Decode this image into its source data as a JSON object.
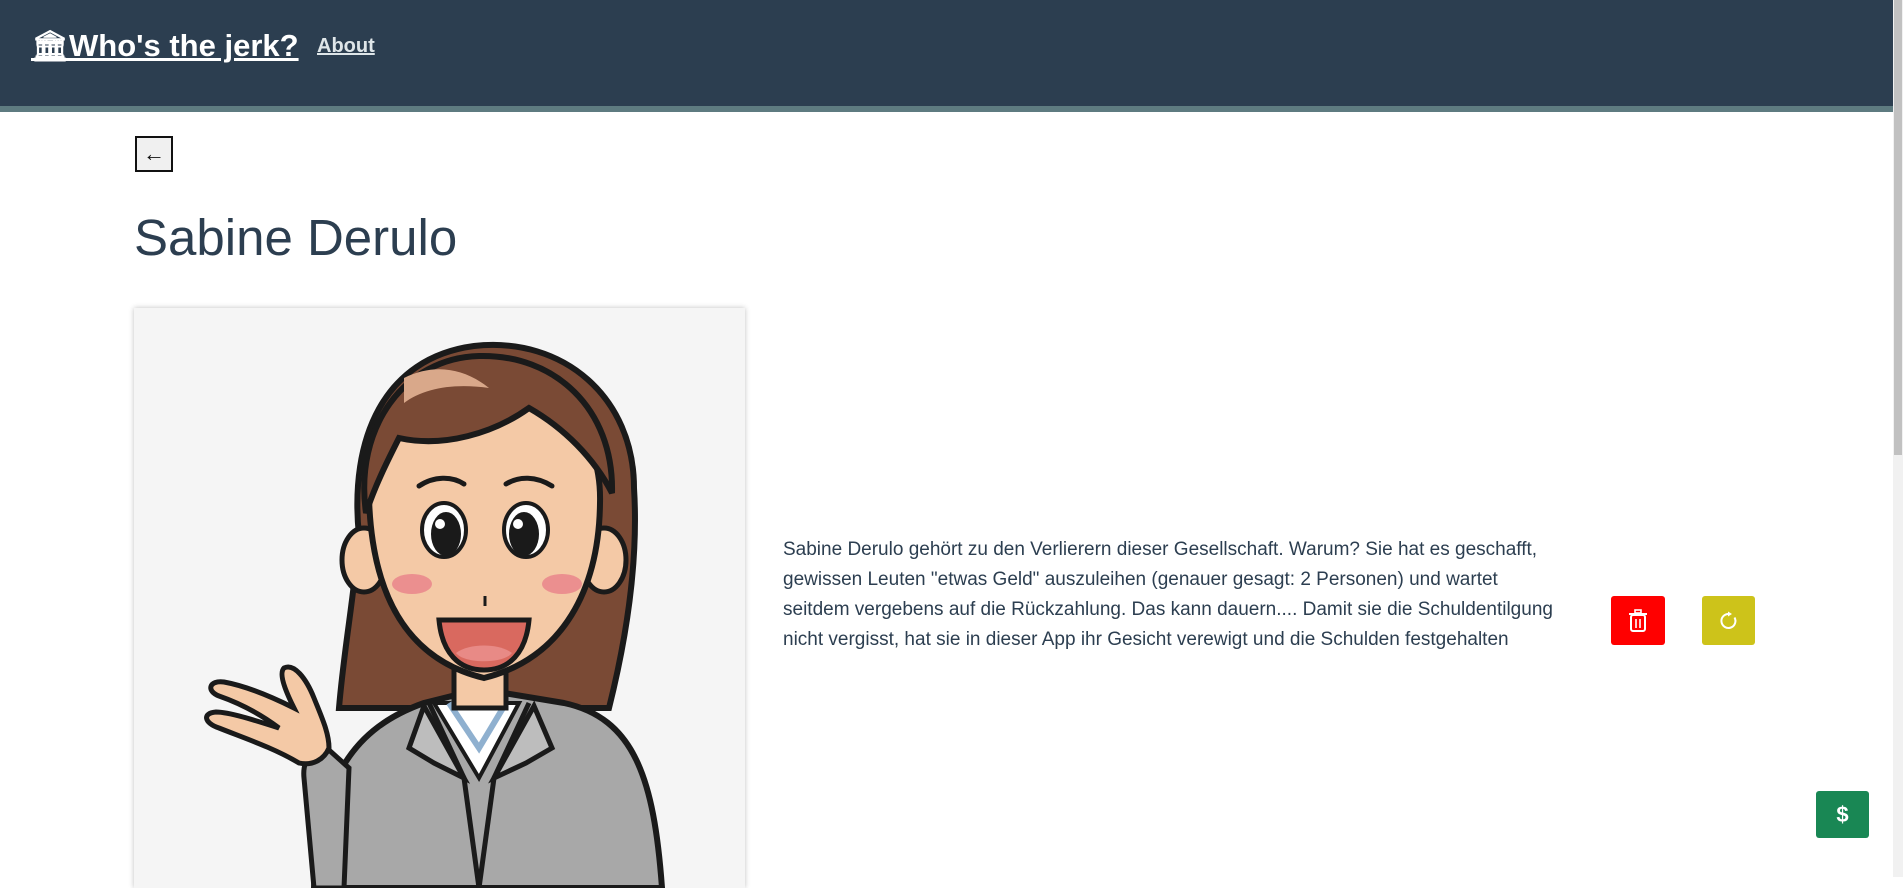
{
  "navbar": {
    "brand_icon": "bank-icon",
    "brand_label": "Who's the jerk?",
    "about_label": "About"
  },
  "back_button": {
    "icon": "arrow-left-icon",
    "symbol": "←"
  },
  "person": {
    "name": "Sabine Derulo",
    "description": "Sabine Derulo gehört zu den Verlierern dieser Gesellschaft. Warum? Sie hat es geschafft, gewissen Leuten \"etwas Geld\" auszuleihen (genauer gesagt: 2 Personen) und wartet seitdem vergebens auf die Rückzahlung. Das kann dauern.... Damit sie die Schuldentilgung nicht vergisst, hat sie in dieser App ihr Gesicht verewigt und die Schulden festgehalten"
  },
  "actions": {
    "delete_icon": "trash-icon",
    "delete_color": "#ff0000",
    "reset_icon": "refresh-icon",
    "reset_color": "#cdc31a",
    "pay_symbol": "$",
    "pay_color": "#198754"
  },
  "colors": {
    "navbar": "#2c3e50",
    "navbar_border": "#5e7b80",
    "text": "#2c3e50"
  }
}
